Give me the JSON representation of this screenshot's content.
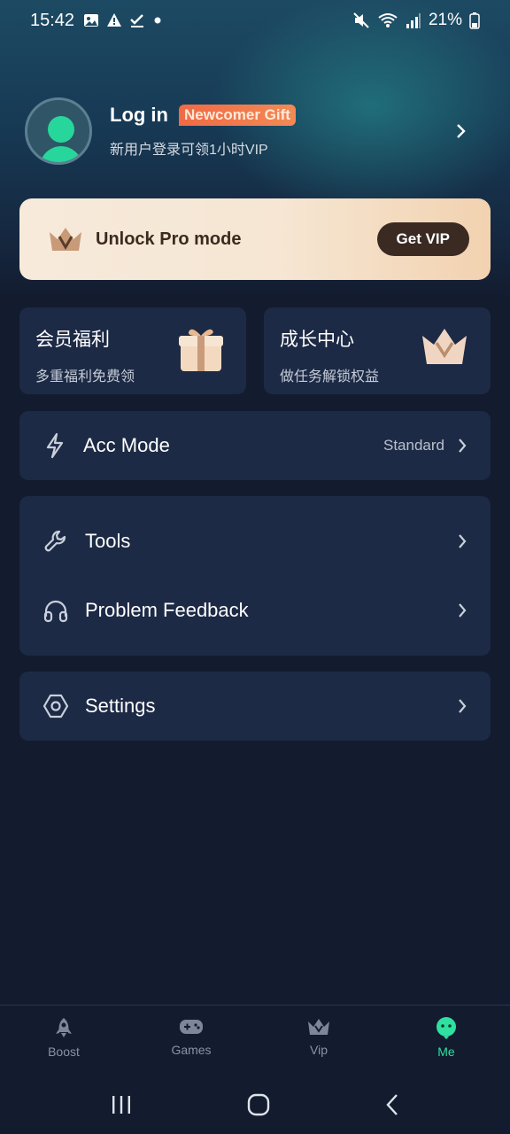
{
  "status_bar": {
    "time": "15:42",
    "battery": "21%",
    "left_icons": [
      "image-icon",
      "warning-icon",
      "check-icon",
      "dot-icon"
    ],
    "right_icons": [
      "mute-icon",
      "wifi-icon",
      "signal-icon",
      "battery-icon"
    ]
  },
  "profile": {
    "login_label": "Log in",
    "gift_badge": "Newcomer Gift",
    "subtitle": "新用户登录可领1小时VIP"
  },
  "vip_banner": {
    "title": "Unlock Pro mode",
    "button": "Get VIP"
  },
  "benefits": [
    {
      "title": "会员福利",
      "subtitle": "多重福利免费领",
      "icon": "gift-icon"
    },
    {
      "title": "成长中心",
      "subtitle": "做任务解锁权益",
      "icon": "crown-icon"
    }
  ],
  "menu": {
    "acc_mode": {
      "label": "Acc Mode",
      "value": "Standard"
    },
    "tools": {
      "label": "Tools"
    },
    "feedback": {
      "label": "Problem Feedback"
    },
    "settings": {
      "label": "Settings"
    }
  },
  "tabs": [
    {
      "label": "Boost",
      "icon": "rocket-icon"
    },
    {
      "label": "Games",
      "icon": "gamepad-icon"
    },
    {
      "label": "Vip",
      "icon": "crown-icon"
    },
    {
      "label": "Me",
      "icon": "me-icon",
      "active": true
    }
  ],
  "colors": {
    "background": "#131b2e",
    "card": "#1d2a45",
    "accent": "#2fe0a0",
    "badge": "#f06a45"
  }
}
